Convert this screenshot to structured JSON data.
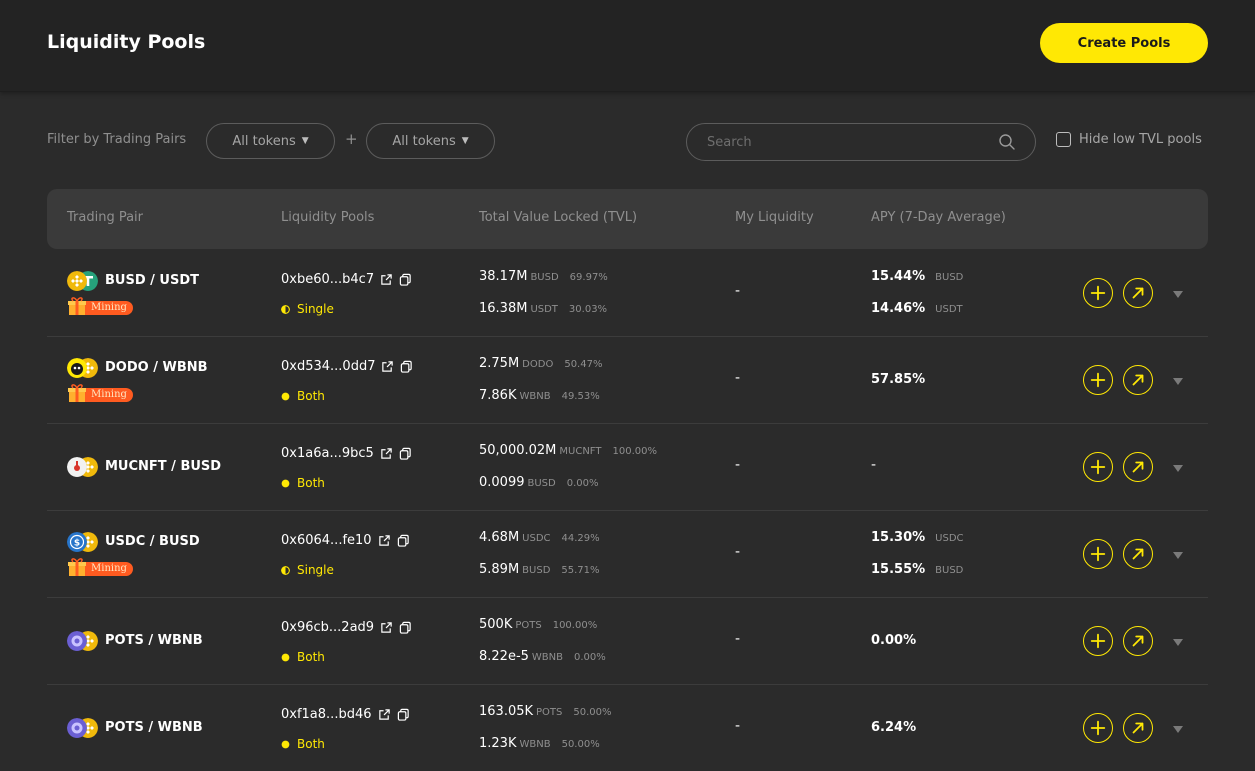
{
  "header": {
    "title": "Liquidity Pools",
    "create_button": "Create Pools"
  },
  "filters": {
    "label": "Filter by Trading Pairs",
    "token_a": "All tokens",
    "separator": "+",
    "token_b": "All tokens",
    "search_placeholder": "Search",
    "hide_low_tvl": "Hide low TVL pools"
  },
  "columns": {
    "pair": "Trading Pair",
    "pools": "Liquidity Pools",
    "tvl": "Total Value Locked (TVL)",
    "my_liquidity": "My Liquidity",
    "apy": "APY (7-Day Average)"
  },
  "colors": {
    "accent": "#ffe804",
    "mining": "#ff5b20",
    "bg": "#2b2b2b",
    "header_bg": "#232323"
  },
  "rows": [
    {
      "pair": "BUSD / USDT",
      "mining": "Mining",
      "address": "0xbe60...b4c7",
      "mode": "Single",
      "tvl": [
        {
          "amount": "38.17M",
          "symbol": "BUSD",
          "pct": "69.97%"
        },
        {
          "amount": "16.38M",
          "symbol": "USDT",
          "pct": "30.03%"
        }
      ],
      "my_liquidity": "-",
      "apy": [
        {
          "value": "15.44%",
          "symbol": "BUSD"
        },
        {
          "value": "14.46%",
          "symbol": "USDT"
        }
      ]
    },
    {
      "pair": "DODO / WBNB",
      "mining": "Mining",
      "address": "0xd534...0dd7",
      "mode": "Both",
      "tvl": [
        {
          "amount": "2.75M",
          "symbol": "DODO",
          "pct": "50.47%"
        },
        {
          "amount": "7.86K",
          "symbol": "WBNB",
          "pct": "49.53%"
        }
      ],
      "my_liquidity": "-",
      "apy_single": "57.85%"
    },
    {
      "pair": "MUCNFT / BUSD",
      "address": "0x1a6a...9bc5",
      "mode": "Both",
      "tvl": [
        {
          "amount": "50,000.02M",
          "symbol": "MUCNFT",
          "pct": "100.00%"
        },
        {
          "amount": "0.0099",
          "symbol": "BUSD",
          "pct": "0.00%"
        }
      ],
      "my_liquidity": "-",
      "apy_single": "-"
    },
    {
      "pair": "USDC / BUSD",
      "mining": "Mining",
      "address": "0x6064...fe10",
      "mode": "Single",
      "tvl": [
        {
          "amount": "4.68M",
          "symbol": "USDC",
          "pct": "44.29%"
        },
        {
          "amount": "5.89M",
          "symbol": "BUSD",
          "pct": "55.71%"
        }
      ],
      "my_liquidity": "-",
      "apy": [
        {
          "value": "15.30%",
          "symbol": "USDC"
        },
        {
          "value": "15.55%",
          "symbol": "BUSD"
        }
      ]
    },
    {
      "pair": "POTS / WBNB",
      "address": "0x96cb...2ad9",
      "mode": "Both",
      "tvl": [
        {
          "amount": "500K",
          "symbol": "POTS",
          "pct": "100.00%"
        },
        {
          "amount": "8.22e-5",
          "symbol": "WBNB",
          "pct": "0.00%"
        }
      ],
      "my_liquidity": "-",
      "apy_single": "0.00%"
    },
    {
      "pair": "POTS / WBNB",
      "address": "0xf1a8...bd46",
      "mode": "Both",
      "tvl": [
        {
          "amount": "163.05K",
          "symbol": "POTS",
          "pct": "50.00%"
        },
        {
          "amount": "1.23K",
          "symbol": "WBNB",
          "pct": "50.00%"
        }
      ],
      "my_liquidity": "-",
      "apy_single": "6.24%"
    }
  ]
}
